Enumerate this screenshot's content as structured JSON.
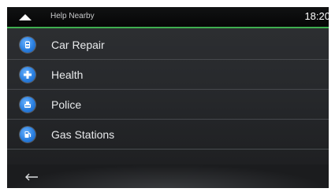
{
  "header": {
    "title": "Help Nearby",
    "time": "18:20"
  },
  "items": [
    {
      "label": "Car Repair",
      "icon": "car-repair-icon"
    },
    {
      "label": "Health",
      "icon": "health-plus-icon"
    },
    {
      "label": "Police",
      "icon": "police-icon"
    },
    {
      "label": "Gas Stations",
      "icon": "gas-station-icon"
    }
  ],
  "footer": {
    "back_icon": "back-arrow-icon"
  },
  "colors": {
    "accent": "#3fae4f",
    "icon_blue": "#2a7fe0"
  }
}
